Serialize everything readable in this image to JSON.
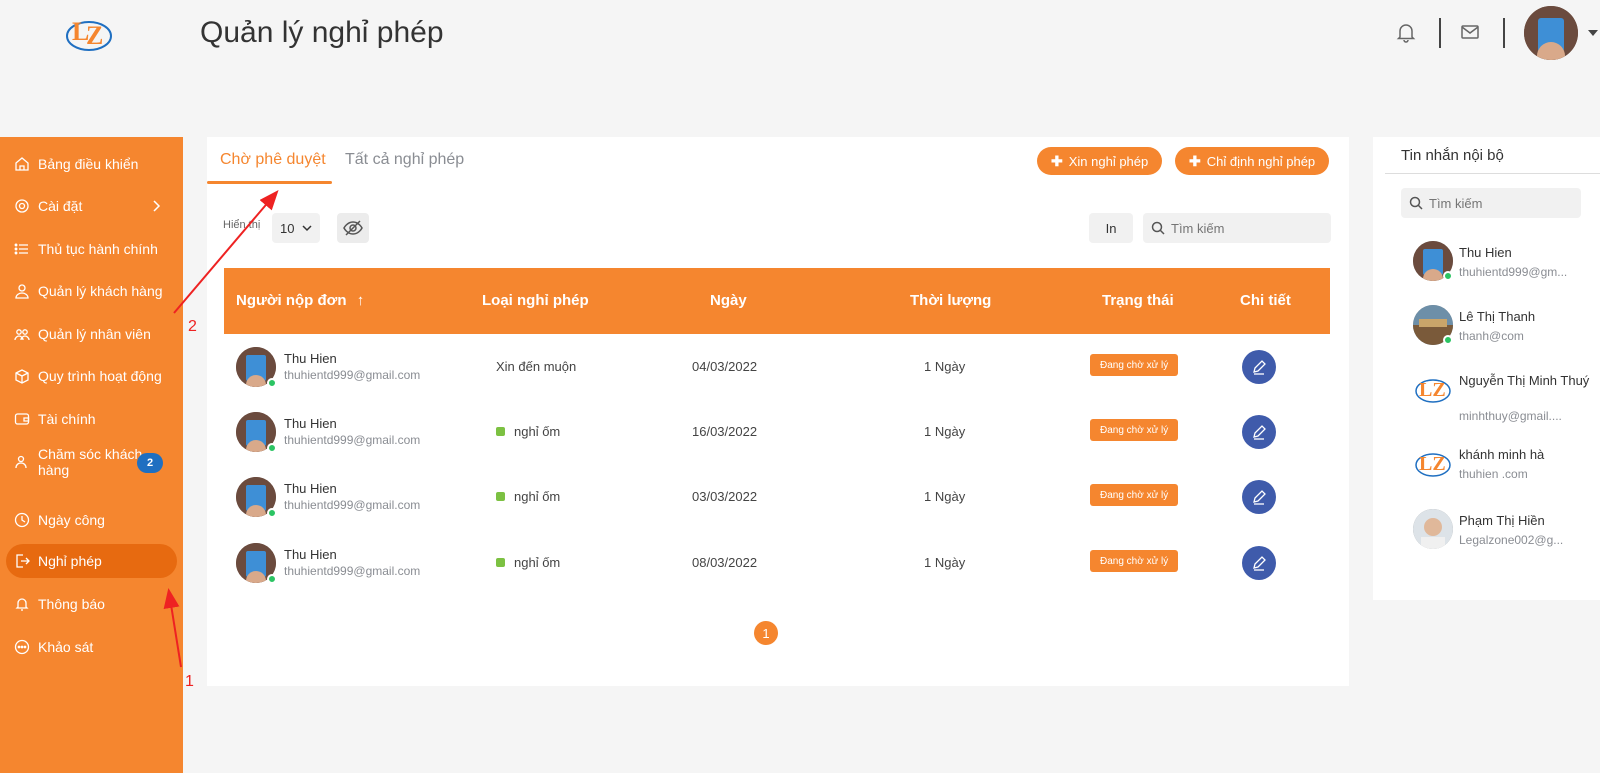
{
  "header": {
    "title": "Quản lý nghỉ phép"
  },
  "sidebar": {
    "items": [
      {
        "label": "Bảng điều khiển"
      },
      {
        "label": "Cài đặt"
      },
      {
        "label": "Thủ tục hành chính"
      },
      {
        "label": "Quản lý khách hàng"
      },
      {
        "label": "Quản lý nhân viên"
      },
      {
        "label": "Quy trình hoạt động"
      },
      {
        "label": "Tài chính"
      },
      {
        "label": "Chăm sóc khách hàng",
        "badge": "2"
      },
      {
        "label": "Ngày công"
      },
      {
        "label": "Nghỉ phép"
      },
      {
        "label": "Thông báo"
      },
      {
        "label": "Khảo sát"
      }
    ]
  },
  "main": {
    "tabs": [
      {
        "label": "Chờ phê duyệt"
      },
      {
        "label": "Tất cả nghỉ phép"
      }
    ],
    "buttons": {
      "request_leave": "Xin nghỉ phép",
      "assign_leave": "Chỉ định nghỉ phép",
      "print": "In"
    },
    "show_label": "Hiển thị",
    "show_value": "10",
    "search_placeholder": "Tìm kiếm",
    "columns": [
      "Người nộp đơn",
      "Loại nghỉ phép",
      "Ngày",
      "Thời lượng",
      "Trạng thái",
      "Chi tiết"
    ],
    "sort_indicator": "↑",
    "rows": [
      {
        "name": "Thu Hien",
        "email": "thuhientd999@gmail.com",
        "type": "Xin đến muộn",
        "date": "04/03/2022",
        "duration": "1 Ngày",
        "status": "Đang chờ xử lý"
      },
      {
        "name": "Thu Hien",
        "email": "thuhientd999@gmail.com",
        "type": "nghỉ ốm",
        "date": "16/03/2022",
        "duration": "1 Ngày",
        "status": "Đang chờ xử lý"
      },
      {
        "name": "Thu Hien",
        "email": "thuhientd999@gmail.com",
        "type": "nghỉ ốm",
        "date": "03/03/2022",
        "duration": "1 Ngày",
        "status": "Đang chờ xử lý"
      },
      {
        "name": "Thu Hien",
        "email": "thuhientd999@gmail.com",
        "type": "nghỉ ốm",
        "date": "08/03/2022",
        "duration": "1 Ngày",
        "status": "Đang chờ xử lý"
      }
    ],
    "page": "1"
  },
  "messages": {
    "title": "Tin nhắn nội bộ",
    "search_placeholder": "Tìm kiếm",
    "contacts": [
      {
        "name": "Thu Hien",
        "email": "thuhientd999@gm..."
      },
      {
        "name": "Lê Thị Thanh",
        "email": "thanh@com"
      },
      {
        "name": "Nguyễn Thị Minh Thuý",
        "email": "minhthuy@gmail...."
      },
      {
        "name": "khánh minh hà",
        "email": "thuhien .com"
      },
      {
        "name": "Phạm Thị Hiền",
        "email": "Legalzone002@g..."
      }
    ]
  },
  "annotations": {
    "one": "1",
    "two": "2"
  },
  "colors": {
    "brand": "#f5862f",
    "brand_active": "#e76a10",
    "edit": "#3f5bab",
    "badge": "#1f6fc1",
    "online": "#2bc463",
    "annotation": "#e22"
  },
  "icons": [
    "logo-icon",
    "bell-icon",
    "mail-icon",
    "home-icon",
    "gear-icon",
    "list-icon",
    "user-icon",
    "users-icon",
    "box-icon",
    "wallet-icon",
    "support-icon",
    "clock-icon",
    "logout-icon",
    "bell-icon",
    "chat-icon",
    "eye-off-icon",
    "search-icon",
    "edit-icon",
    "chevron-down-icon",
    "chevron-right-icon"
  ]
}
